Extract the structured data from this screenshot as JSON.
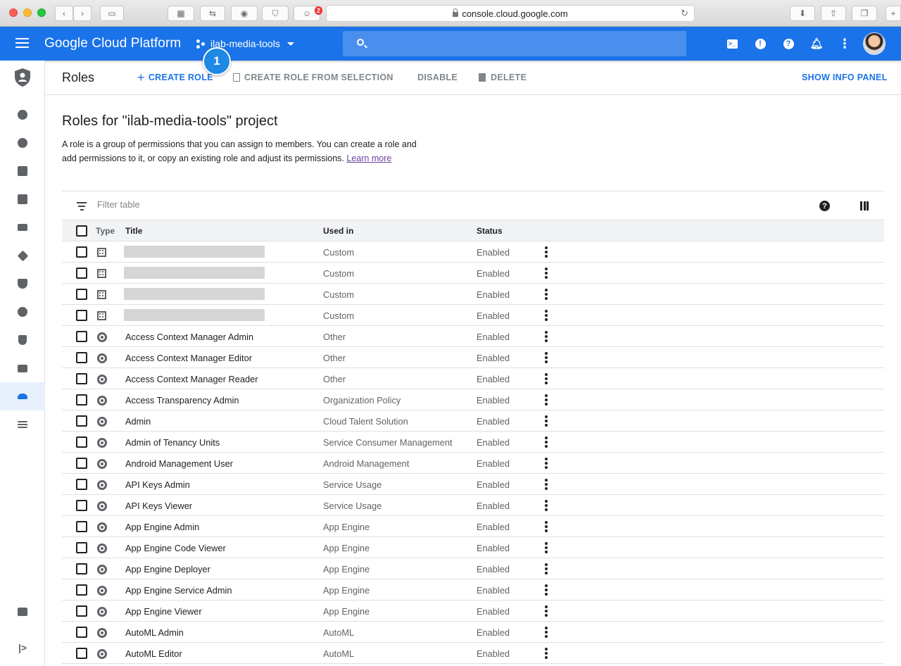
{
  "browser": {
    "url": "console.cloud.google.com",
    "ext_badge_count": "2"
  },
  "header": {
    "brand": "Google Cloud Platform",
    "project": "ilab-media-tools",
    "search_placeholder": "",
    "step_badge": "1"
  },
  "toolbar": {
    "title": "Roles",
    "create_role": "CREATE ROLE",
    "create_from_selection": "CREATE ROLE FROM SELECTION",
    "disable": "DISABLE",
    "delete": "DELETE",
    "info_panel": "SHOW INFO PANEL"
  },
  "content": {
    "heading": "Roles for \"ilab-media-tools\" project",
    "description": "A role is a group of permissions that you can assign to members. You can create a role and add permissions to it, or copy an existing role and adjust its permissions.",
    "learn_more": "Learn more",
    "filter_placeholder": "Filter table"
  },
  "table": {
    "columns": {
      "type": "Type",
      "title": "Title",
      "used_in": "Used in",
      "status": "Status"
    },
    "rows": [
      {
        "type": "custom",
        "title": "",
        "used_in": "Custom",
        "status": "Enabled"
      },
      {
        "type": "custom",
        "title": "",
        "used_in": "Custom",
        "status": "Enabled"
      },
      {
        "type": "custom",
        "title": "",
        "used_in": "Custom",
        "status": "Enabled"
      },
      {
        "type": "custom",
        "title": "",
        "used_in": "Custom",
        "status": "Enabled"
      },
      {
        "type": "predefined",
        "title": "Access Context Manager Admin",
        "used_in": "Other",
        "status": "Enabled"
      },
      {
        "type": "predefined",
        "title": "Access Context Manager Editor",
        "used_in": "Other",
        "status": "Enabled"
      },
      {
        "type": "predefined",
        "title": "Access Context Manager Reader",
        "used_in": "Other",
        "status": "Enabled"
      },
      {
        "type": "predefined",
        "title": "Access Transparency Admin",
        "used_in": "Organization Policy",
        "status": "Enabled"
      },
      {
        "type": "predefined",
        "title": "Admin",
        "used_in": "Cloud Talent Solution",
        "status": "Enabled"
      },
      {
        "type": "predefined",
        "title": "Admin of Tenancy Units",
        "used_in": "Service Consumer Management",
        "status": "Enabled"
      },
      {
        "type": "predefined",
        "title": "Android Management User",
        "used_in": "Android Management",
        "status": "Enabled"
      },
      {
        "type": "predefined",
        "title": "API Keys Admin",
        "used_in": "Service Usage",
        "status": "Enabled"
      },
      {
        "type": "predefined",
        "title": "API Keys Viewer",
        "used_in": "Service Usage",
        "status": "Enabled"
      },
      {
        "type": "predefined",
        "title": "App Engine Admin",
        "used_in": "App Engine",
        "status": "Enabled"
      },
      {
        "type": "predefined",
        "title": "App Engine Code Viewer",
        "used_in": "App Engine",
        "status": "Enabled"
      },
      {
        "type": "predefined",
        "title": "App Engine Deployer",
        "used_in": "App Engine",
        "status": "Enabled"
      },
      {
        "type": "predefined",
        "title": "App Engine Service Admin",
        "used_in": "App Engine",
        "status": "Enabled"
      },
      {
        "type": "predefined",
        "title": "App Engine Viewer",
        "used_in": "App Engine",
        "status": "Enabled"
      },
      {
        "type": "predefined",
        "title": "AutoML Admin",
        "used_in": "AutoML",
        "status": "Enabled"
      },
      {
        "type": "predefined",
        "title": "AutoML Editor",
        "used_in": "AutoML",
        "status": "Enabled"
      }
    ]
  },
  "sidenav": {
    "items": [
      "add-member-icon",
      "account-icon",
      "document-icon",
      "storage-icon",
      "transfer-icon",
      "tag-icon",
      "shield-icon",
      "settings-icon",
      "security-icon",
      "list-icon",
      "roles-icon",
      "menu-list-icon"
    ],
    "active_index": 10
  },
  "colors": {
    "header": "#1a73e8",
    "accent": "#1a73e8"
  }
}
